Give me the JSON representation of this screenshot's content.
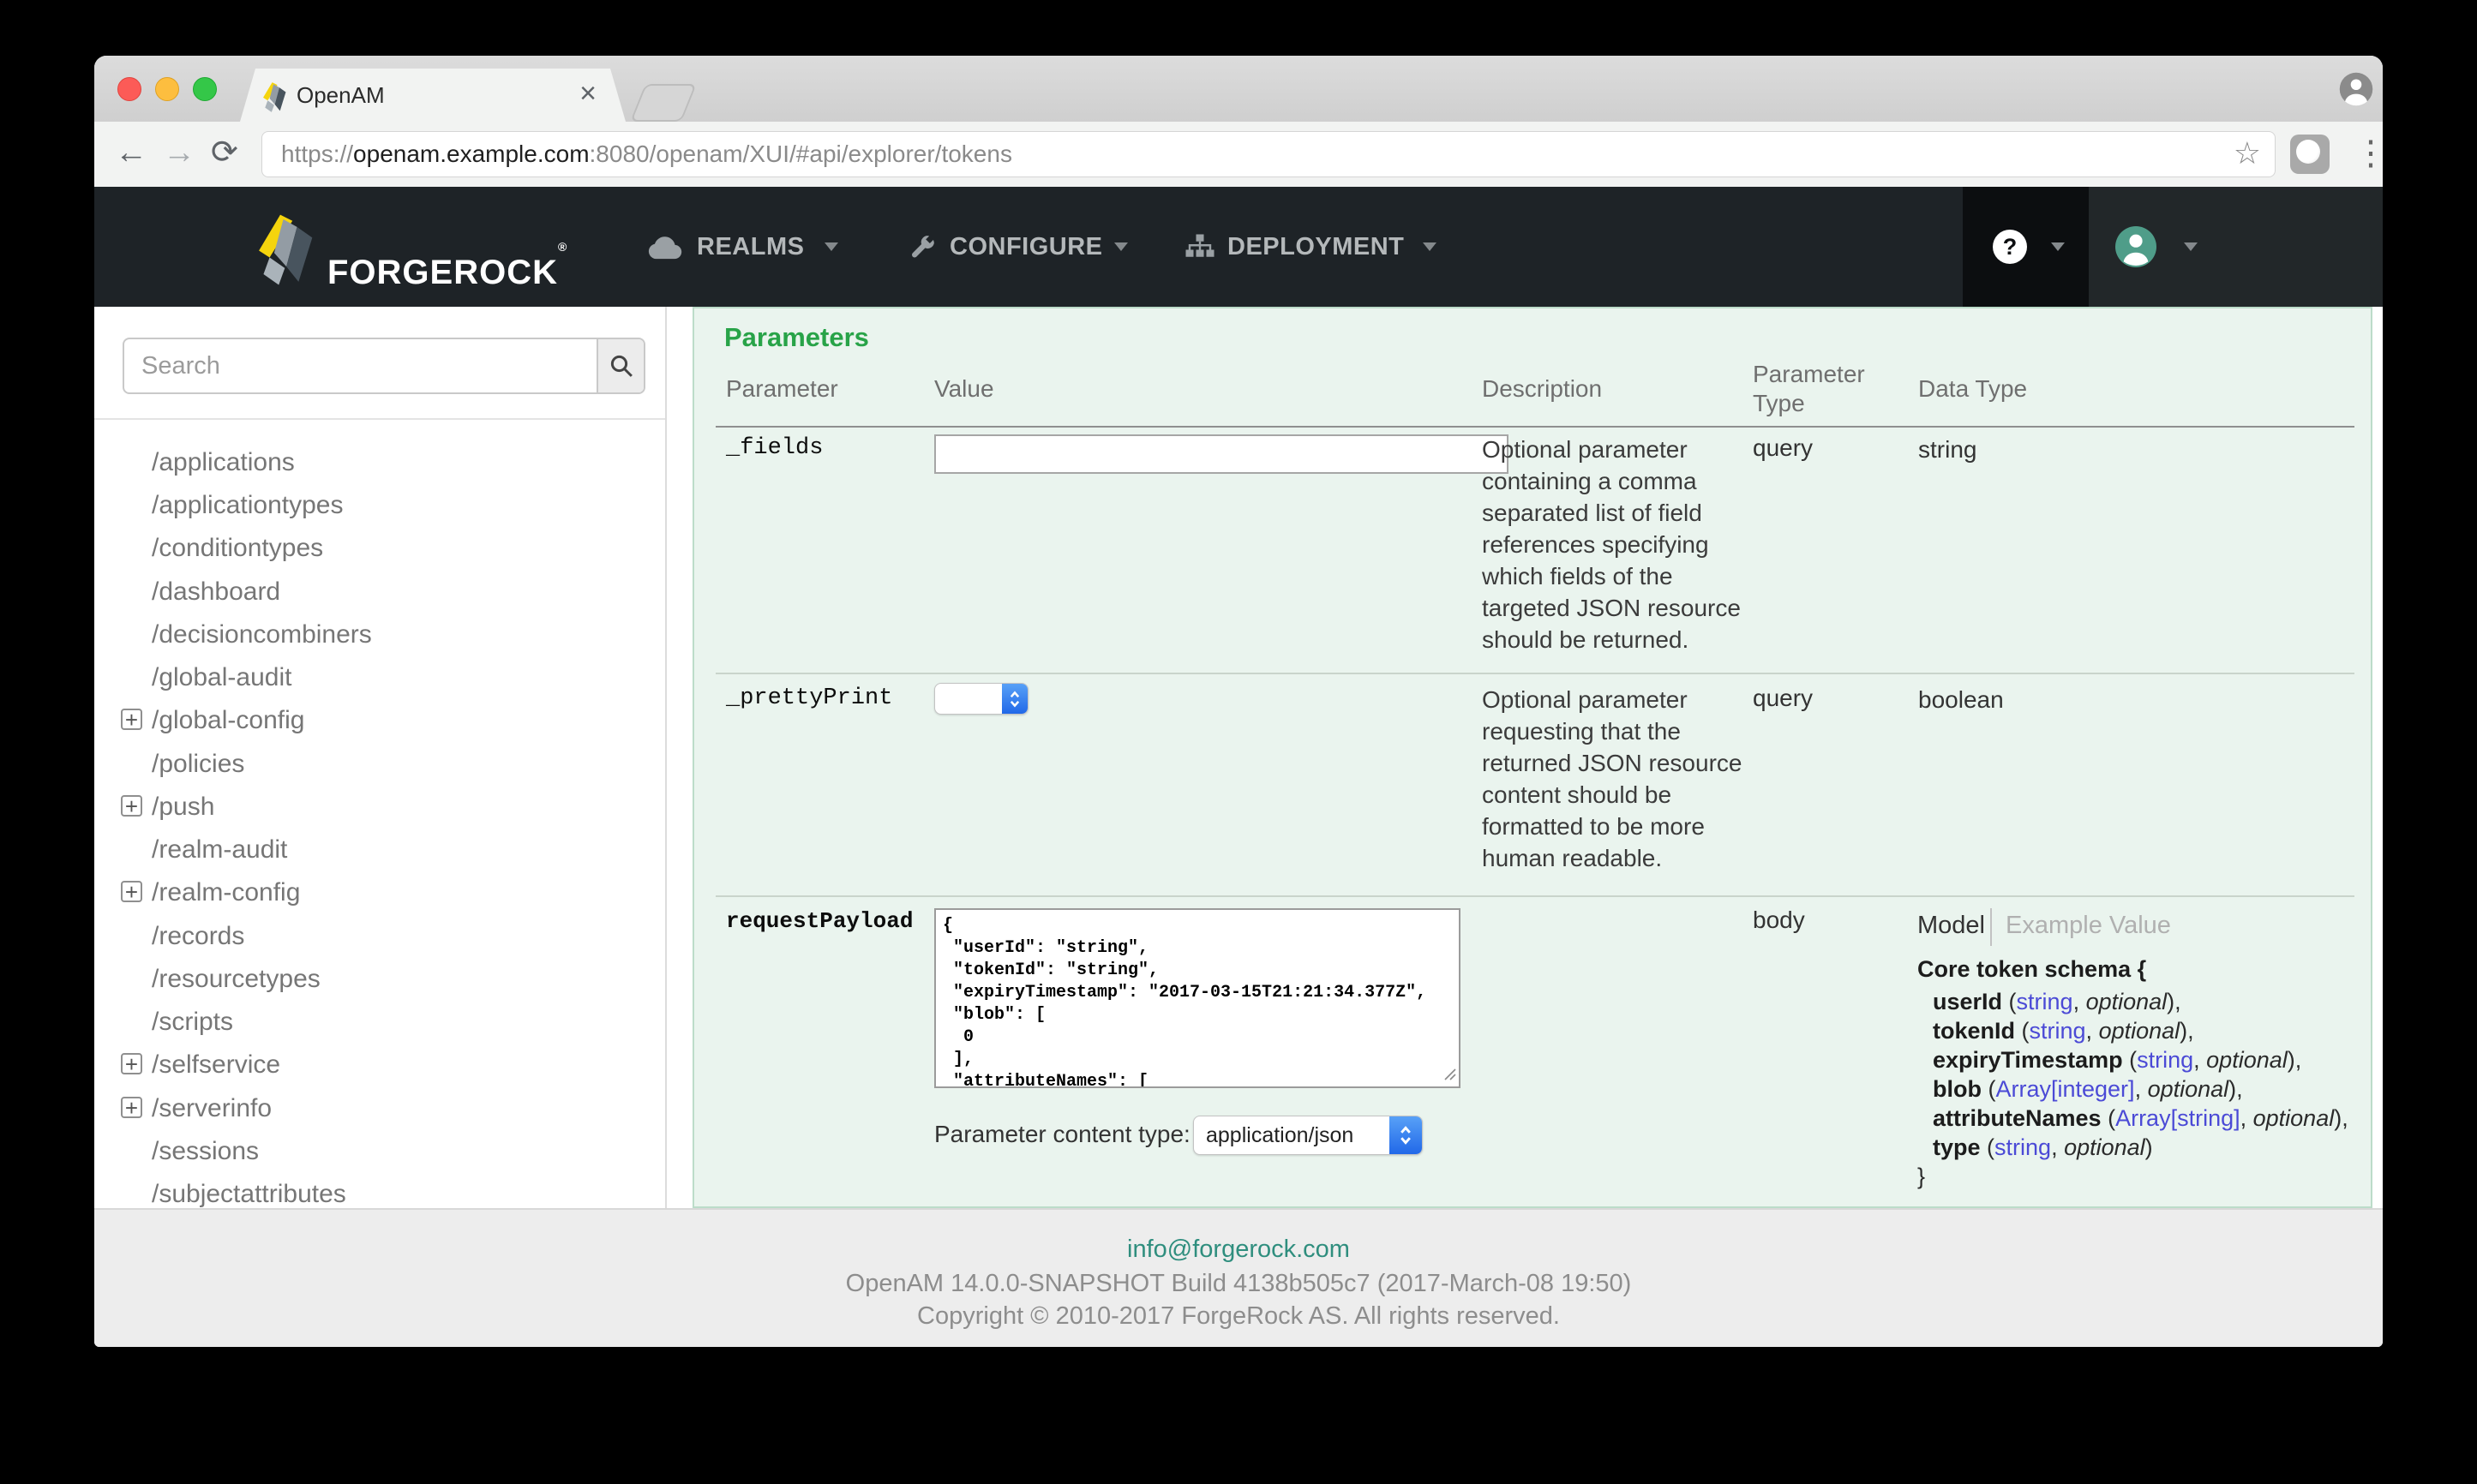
{
  "browser": {
    "tab_title": "OpenAM",
    "url": {
      "protocol": "https://",
      "host": "openam.example.com",
      "path": ":8080/openam/XUI/#api/explorer/tokens"
    },
    "glyphs": {
      "back": "←",
      "forward": "→",
      "reload": "⟳",
      "star": "☆",
      "menu": "⋮",
      "close_tab": "×"
    }
  },
  "navbar": {
    "brand": "FORGEROCK",
    "trademark": "®",
    "help_glyph": "?",
    "menus": [
      {
        "label": "REALMS"
      },
      {
        "label": "CONFIGURE"
      },
      {
        "label": "DEPLOYMENT"
      }
    ]
  },
  "sidebar": {
    "search_placeholder": "Search",
    "expand_glyph": "+",
    "items": [
      {
        "label": "/applications"
      },
      {
        "label": "/applicationtypes"
      },
      {
        "label": "/conditiontypes"
      },
      {
        "label": "/dashboard"
      },
      {
        "label": "/decisioncombiners"
      },
      {
        "label": "/global-audit"
      },
      {
        "label": "/global-config",
        "expandable": true
      },
      {
        "label": "/policies"
      },
      {
        "label": "/push",
        "expandable": true
      },
      {
        "label": "/realm-audit"
      },
      {
        "label": "/realm-config",
        "expandable": true
      },
      {
        "label": "/records"
      },
      {
        "label": "/resourcetypes"
      },
      {
        "label": "/scripts"
      },
      {
        "label": "/selfservice",
        "expandable": true
      },
      {
        "label": "/serverinfo",
        "expandable": true
      },
      {
        "label": "/sessions"
      },
      {
        "label": "/subjectattributes"
      }
    ]
  },
  "main": {
    "title": "Parameters",
    "columns": {
      "parameter": "Parameter",
      "value": "Value",
      "description": "Description",
      "parameter_type": "Parameter Type",
      "data_type": "Data Type"
    },
    "rows": [
      {
        "name": "_fields",
        "value": "",
        "param_type": "query",
        "data_type": "string",
        "description_lines": [
          "Optional parameter",
          "containing a comma",
          "separated list of field",
          "references specifying",
          "which fields of the",
          "targeted JSON resource",
          "should be returned."
        ]
      },
      {
        "name": "_prettyPrint",
        "value": "",
        "param_type": "query",
        "data_type": "boolean",
        "description_lines": [
          "Optional parameter",
          "requesting that the",
          "returned JSON resource",
          "content should be",
          "formatted to be more",
          "human readable."
        ]
      },
      {
        "name": "requestPayload",
        "param_type": "body",
        "payload_text": "{\n \"userId\": \"string\",\n \"tokenId\": \"string\",\n \"expiryTimestamp\": \"2017-03-15T21:21:34.377Z\",\n \"blob\": [\n  0\n ],\n \"attributeNames\": [",
        "content_type_label": "Parameter content type:",
        "content_type_value": "application/json",
        "tabs": {
          "model": "Model",
          "example": "Example Value"
        },
        "schema": {
          "title": "Core token schema {",
          "closing": "}",
          "punct": {
            "open": " (",
            "sep": ", "
          },
          "optional_word": "optional",
          "props": [
            {
              "name": "userId",
              "type": "string",
              "close": "),"
            },
            {
              "name": "tokenId",
              "type": "string",
              "close": "),"
            },
            {
              "name": "expiryTimestamp",
              "type": "string",
              "close": "),"
            },
            {
              "name": "blob",
              "type": "Array[integer]",
              "close": "),"
            },
            {
              "name": "attributeNames",
              "type": "Array[string]",
              "close": "),"
            },
            {
              "name": "type",
              "type": "string",
              "close": ")"
            }
          ]
        }
      }
    ]
  },
  "footer": {
    "email": "info@forgerock.com",
    "build": "OpenAM 14.0.0-SNAPSHOT Build 4138b505c7 (2017-March-08 19:50)",
    "copyright": "Copyright © 2010-2017 ForgeRock AS. All rights reserved."
  },
  "colors": {
    "accent_green": "#28a348",
    "footer_link": "#2f8e7e",
    "schema_type": "#4b4ad6",
    "avatar": "#4f9d89"
  }
}
